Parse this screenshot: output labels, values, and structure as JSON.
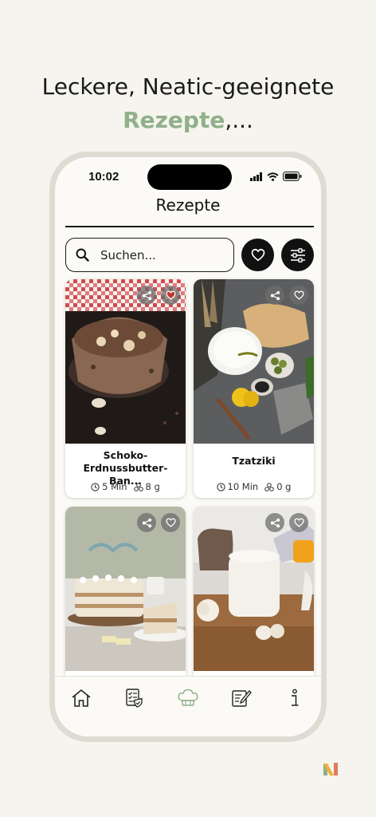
{
  "headline": {
    "line1": "Leckere, Neatic-geeignete",
    "accent": "Rezepte",
    "suffix": ",..."
  },
  "status": {
    "time": "10:02"
  },
  "page": {
    "title": "Rezepte"
  },
  "search": {
    "placeholder": "Suchen..."
  },
  "recipes": [
    {
      "name": "Schoko-Erdnussbutter-Ban...",
      "time": "5 Min",
      "amount": "8 g",
      "favorite": true
    },
    {
      "name": "Tzatziki",
      "time": "10 Min",
      "amount": "0 g",
      "favorite": false
    },
    {
      "name": "",
      "time": "",
      "amount": "",
      "favorite": false
    },
    {
      "name": "",
      "time": "",
      "amount": "",
      "favorite": false
    }
  ],
  "nav": {
    "items": [
      "home-icon",
      "checklist-icon",
      "chef-hat-icon",
      "notes-icon",
      "info-icon"
    ],
    "active": "chef-hat-icon"
  },
  "colors": {
    "accent": "#8fb08a",
    "background": "#f6f4ef",
    "favorite": "#c0392b"
  }
}
